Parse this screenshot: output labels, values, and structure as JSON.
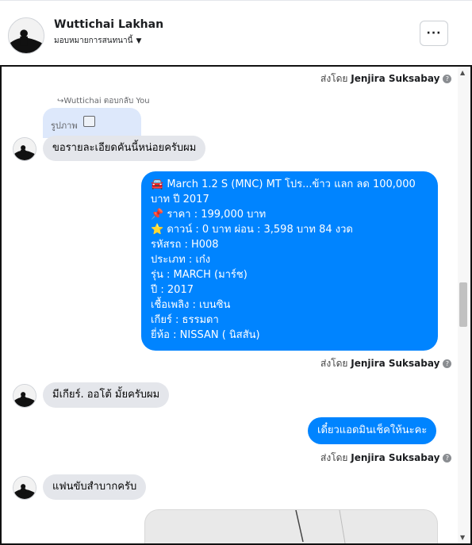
{
  "header": {
    "name": "Wuttichai Lakhan",
    "subtitle": "มอบหมายการสนทนานี้",
    "more": "···"
  },
  "chat": {
    "sent_prefix": "ส่งโดย",
    "sender": "Jenjira Suksabay",
    "reply_note": "Wuttichai ตอบกลับ You",
    "reply_preview": "รูปภาพ",
    "messages": {
      "m1": "ขอรายละเอียดคันนี้หน่อยครับผม",
      "long_lines": [
        "🚘 March 1.2 S (MNC) MT โปร...ข้าว แลก ลด 100,000",
        "บาท ปี 2017",
        "📌 ราคา : 199,000 บาท",
        "⭐ ดาวน์ : 0 บาท ผ่อน : 3,598 บาท 84 งวด",
        "    รหัสรถ : H008",
        "    ประเภท : เก๋ง",
        "    รุ่น : MARCH (มาร์ช)",
        "    ปี : 2017",
        "    เชื้อเพลิง : เบนซิน",
        "    เกียร์ : ธรรมดา",
        "    ยี่ห้อ : NISSAN ( นิสสัน)"
      ],
      "m2": "มีเกียร์. ออโต้ มั้ยครับผม",
      "m3": "เดี๋ยวแอดมินเช็คให้นะคะ",
      "m4": "แฟนขับสำบากครับ"
    }
  },
  "colors": {
    "outgoing": "#0084ff",
    "incoming": "#e4e6eb",
    "reply": "#dde8fb"
  },
  "icons": [
    "more-icon",
    "caret-down-icon",
    "info-icon",
    "image-icon",
    "pin-icon",
    "star-icon",
    "car-icon"
  ]
}
